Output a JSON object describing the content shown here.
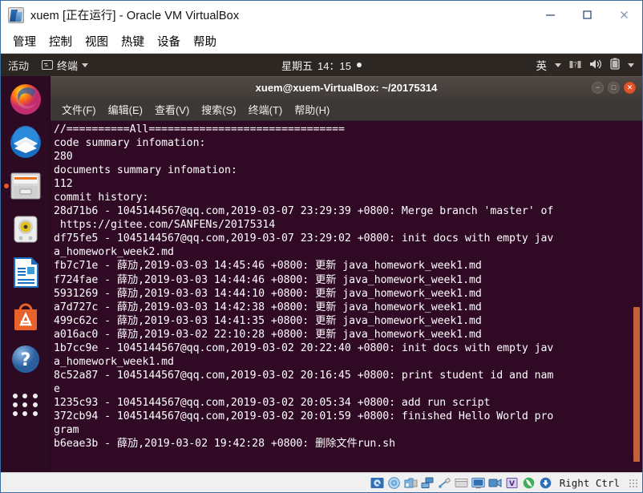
{
  "host_window": {
    "title": "xuem [正在运行] - Oracle VM VirtualBox",
    "icon": "virtualbox-icon",
    "minimize_label": "—",
    "maximize_label": "□",
    "close_label": "✕",
    "menu": [
      {
        "label": "管理"
      },
      {
        "label": "控制"
      },
      {
        "label": "视图"
      },
      {
        "label": "热键"
      },
      {
        "label": "设备"
      },
      {
        "label": "帮助"
      }
    ]
  },
  "gnome_topbar": {
    "activities": "活动",
    "app_menu": "终端",
    "app_icon": "terminal-icon",
    "clock_day": "星期五",
    "clock_time": "14：15",
    "input_method": "英",
    "icons": [
      "network-icon",
      "volume-icon",
      "battery-icon",
      "chevron-down-icon"
    ]
  },
  "dock": {
    "items": [
      {
        "name": "firefox",
        "label": "Firefox",
        "running": false
      },
      {
        "name": "thunderbird",
        "label": "Thunderbird Mail",
        "running": false
      },
      {
        "name": "files",
        "label": "Files",
        "running": true
      },
      {
        "name": "rhythmbox",
        "label": "Rhythmbox",
        "running": false
      },
      {
        "name": "libreoffice-writer",
        "label": "LibreOffice Writer",
        "running": false
      },
      {
        "name": "ubuntu-software",
        "label": "Ubuntu Software",
        "running": false
      },
      {
        "name": "help",
        "label": "Help",
        "running": false
      },
      {
        "name": "show-applications",
        "label": "Show Applications",
        "running": false
      }
    ]
  },
  "terminal": {
    "title": "xuem@xuem-VirtualBox: ~/20175314",
    "window_buttons": {
      "minimize": "−",
      "maximize": "□",
      "close": "✕"
    },
    "menu": [
      {
        "label": "文件(F)"
      },
      {
        "label": "编辑(E)"
      },
      {
        "label": "查看(V)"
      },
      {
        "label": "搜索(S)"
      },
      {
        "label": "终端(T)"
      },
      {
        "label": "帮助(H)"
      }
    ],
    "content": "//==========All===============================\ncode summary infomation:\n280\ndocuments summary infomation:\n112\ncommit history:\n28d71b6 - 1045144567@qq.com,2019-03-07 23:29:39 +0800: Merge branch 'master' of\n https://gitee.com/SANFENs/20175314\ndf75fe5 - 1045144567@qq.com,2019-03-07 23:29:02 +0800: init docs with empty jav\na_homework_week2.md\nfb7c71e - 薛劢,2019-03-03 14:45:46 +0800: 更新 java_homework_week1.md\nf724fae - 薛劢,2019-03-03 14:44:46 +0800: 更新 java_homework_week1.md\n5931269 - 薛劢,2019-03-03 14:44:10 +0800: 更新 java_homework_week1.md\na7d727c - 薛劢,2019-03-03 14:42:38 +0800: 更新 java_homework_week1.md\n499c62c - 薛劢,2019-03-03 14:41:35 +0800: 更新 java_homework_week1.md\na016ac0 - 薛劢,2019-03-02 22:10:28 +0800: 更新 java_homework_week1.md\n1b7cc9e - 1045144567@qq.com,2019-03-02 20:22:40 +0800: init docs with empty jav\na_homework_week1.md\n8c52a87 - 1045144567@qq.com,2019-03-02 20:16:45 +0800: print student id and nam\ne\n1235c93 - 1045144567@qq.com,2019-03-02 20:05:34 +0800: add run script\n372cb94 - 1045144567@qq.com,2019-03-02 20:01:59 +0800: finished Hello World pro\ngram\nb6eae3b - 薛劢,2019-03-02 19:42:28 +0800: 删除文件run.sh",
    "scrollbar": {
      "thumb_top_pct": 53,
      "thumb_height_pct": 44,
      "color": "#c4603c"
    },
    "background_color": "#300a24",
    "foreground_color": "#ffffff"
  },
  "status_bar": {
    "host_key": "Right Ctrl",
    "icons": [
      "harddisk-icon",
      "optical-disk-icon",
      "floppy-icon",
      "network-icon",
      "usb-icon",
      "shared-folder-icon",
      "display-icon",
      "recording-icon",
      "virtualization-icon",
      "mouse-integration-icon",
      "keyboard-capture-icon"
    ]
  },
  "colors": {
    "terminal_bg": "#300a24",
    "terminal_titlebar": "#413b37",
    "gnome_topbar_bg": "#2d2723",
    "dock_bg": "#2b0a22",
    "accent_orange": "#e8572a",
    "host_border": "#3a6ea5"
  }
}
